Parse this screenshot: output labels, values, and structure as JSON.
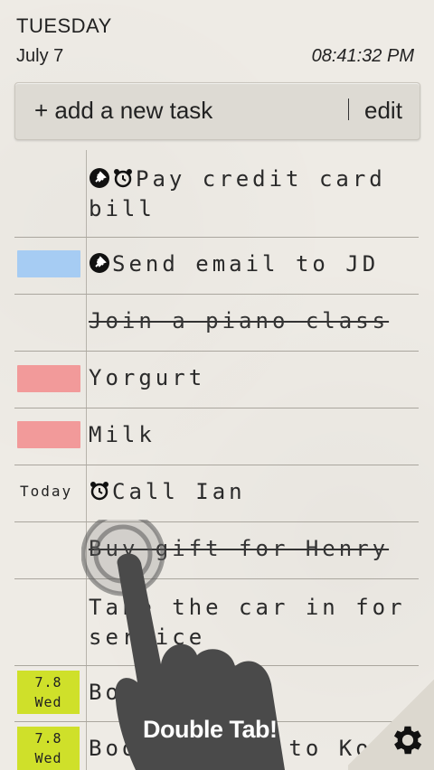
{
  "header": {
    "day": "TUESDAY",
    "date": "July 7",
    "time": "08:41:32 PM"
  },
  "toolbar": {
    "add_label": "+ add a new task",
    "edit_label": "edit"
  },
  "tasks": [
    {
      "text": "Pay credit card bill",
      "icons": [
        "pin-icon",
        "alarm-icon"
      ],
      "done": false,
      "tag": null
    },
    {
      "text": "Send email to JD",
      "icons": [
        "pin-icon"
      ],
      "done": false,
      "tag": {
        "type": "color",
        "color": "#a6ccf3"
      }
    },
    {
      "text": "Join a piano class",
      "icons": [],
      "done": true,
      "tag": null
    },
    {
      "text": "Yorgurt",
      "icons": [],
      "done": false,
      "tag": {
        "type": "color",
        "color": "#f29a9a"
      }
    },
    {
      "text": "Milk",
      "icons": [],
      "done": false,
      "tag": {
        "type": "color",
        "color": "#f29a9a"
      }
    },
    {
      "text": "Call Ian",
      "icons": [
        "alarm-icon"
      ],
      "done": false,
      "tag": {
        "type": "text",
        "label": "Today"
      }
    },
    {
      "text": "Buy gift for Henry",
      "icons": [],
      "done": true,
      "tag": null
    },
    {
      "text": "Take the car in for service",
      "icons": [],
      "done": false,
      "tag": null
    },
    {
      "text": "Book hotel",
      "icons": [],
      "done": false,
      "tag": {
        "type": "date",
        "line1": "7.8",
        "line2": "Wed"
      }
    },
    {
      "text": "Book flight to Kore",
      "icons": [],
      "done": false,
      "tag": {
        "type": "date",
        "line1": "7.8",
        "line2": "Wed"
      }
    }
  ],
  "overlay": {
    "hint": "Double Tab!"
  },
  "colors": {
    "accent_blue": "#a6ccf3",
    "accent_pink": "#f29a9a",
    "date_chip": "#cfe02a"
  }
}
